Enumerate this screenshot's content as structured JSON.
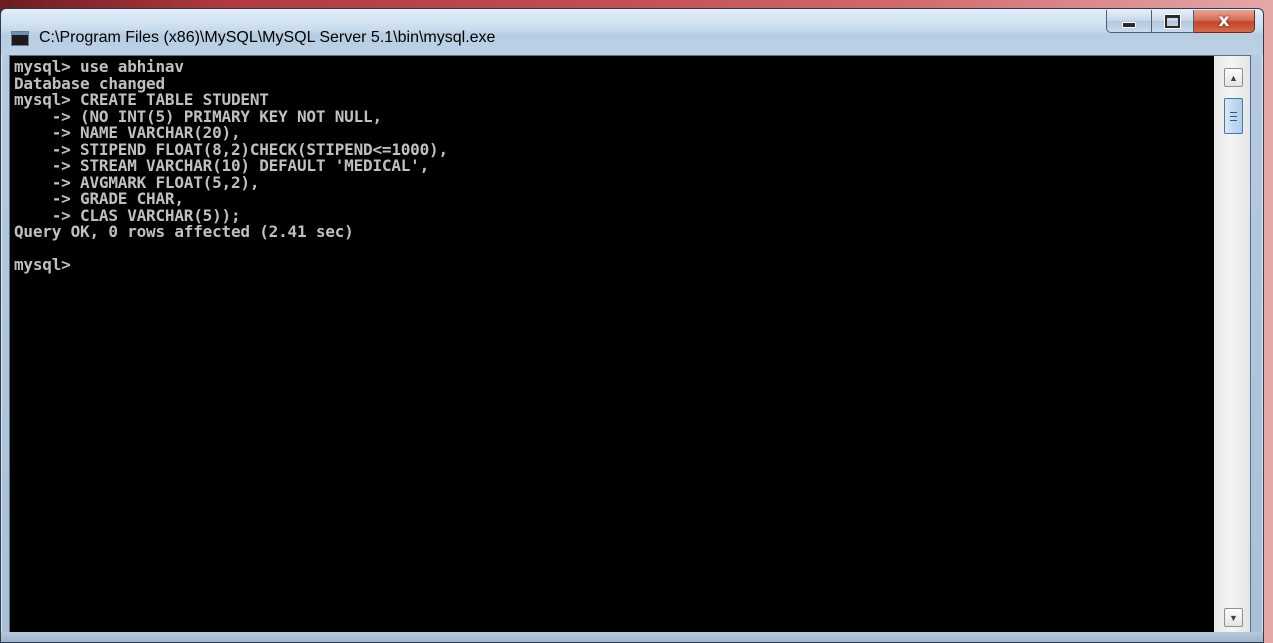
{
  "window": {
    "title": "C:\\Program Files (x86)\\MySQL\\MySQL Server 5.1\\bin\\mysql.exe",
    "icon": "console-icon",
    "buttons": {
      "minimize_icon": "minimize-icon",
      "maximize_icon": "maximize-icon",
      "close_glyph": "x"
    }
  },
  "console": {
    "background": "#000000",
    "text_color": "#c0c0c0",
    "output": "mysql> use abhinav\nDatabase changed\nmysql> CREATE TABLE STUDENT\n    -> (NO INT(5) PRIMARY KEY NOT NULL,\n    -> NAME VARCHAR(20),\n    -> STIPEND FLOAT(8,2)CHECK(STIPEND<=1000),\n    -> STREAM VARCHAR(10) DEFAULT 'MEDICAL',\n    -> AVGMARK FLOAT(5,2),\n    -> GRADE CHAR,\n    -> CLAS VARCHAR(5));\nQuery OK, 0 rows affected (2.41 sec)\n\nmysql>"
  },
  "scrollbar": {
    "up_arrow": "▲",
    "down_arrow": "▼"
  }
}
